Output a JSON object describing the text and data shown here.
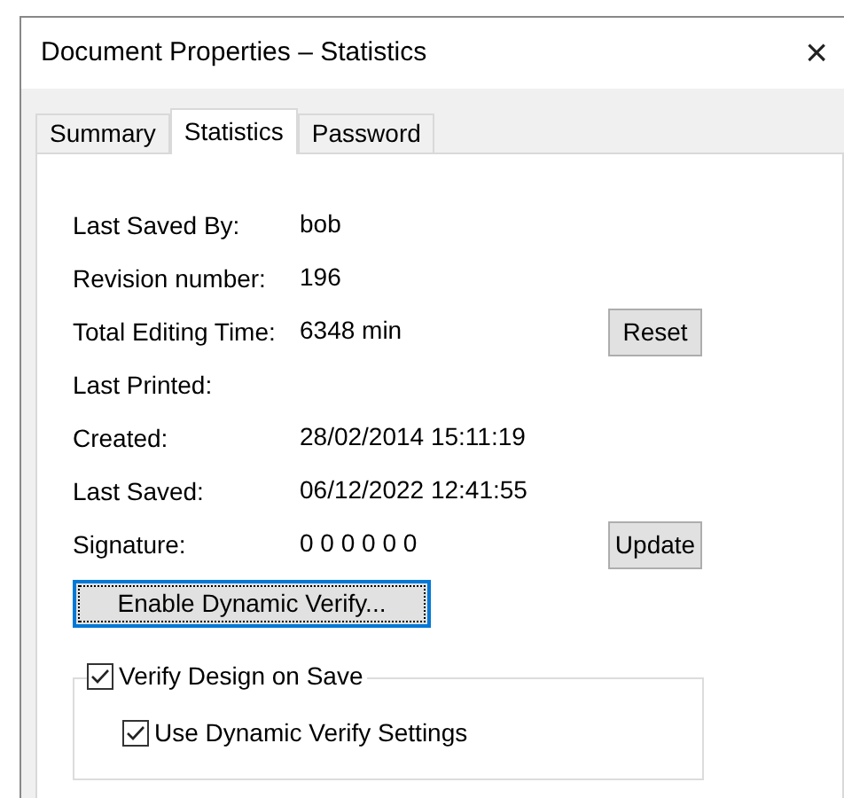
{
  "window": {
    "title": "Document Properties – Statistics",
    "close": "×"
  },
  "tabs": [
    {
      "label": "Summary",
      "selected": false
    },
    {
      "label": "Statistics",
      "selected": true
    },
    {
      "label": "Password",
      "selected": false
    }
  ],
  "fields": [
    {
      "label": "Last Saved By:",
      "value": "bob"
    },
    {
      "label": "Revision number:",
      "value": "196"
    },
    {
      "label": "Total Editing Time:",
      "value": "6348 min",
      "button": "Reset"
    },
    {
      "label": "Last Printed:"
    },
    {
      "label": "Created:",
      "value": "28/02/2014 15:11:19"
    },
    {
      "label": "Last Saved:",
      "value": "06/12/2022 12:41:55"
    },
    {
      "label": "Signature:",
      "value": "0 0 0 0 0 0",
      "button": "Update"
    }
  ],
  "enable_button": {
    "label": "Enable Dynamic Verify...",
    "focused": true
  },
  "verify_group": {
    "label": "Verify Design on Save",
    "checked": true,
    "options": [
      {
        "label": "Use Dynamic Verify Settings",
        "checked": true
      }
    ]
  }
}
